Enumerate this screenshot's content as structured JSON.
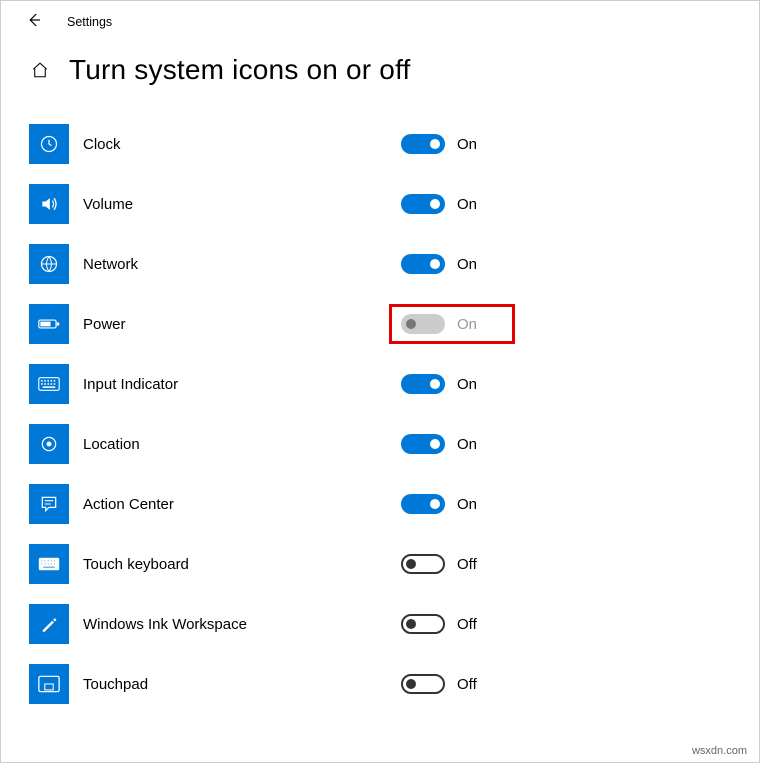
{
  "header": {
    "app_label": "Settings",
    "page_title": "Turn system icons on or off"
  },
  "states": {
    "on": "On",
    "off": "Off"
  },
  "items": [
    {
      "id": "clock",
      "label": "Clock",
      "enabled": true,
      "on": true
    },
    {
      "id": "volume",
      "label": "Volume",
      "enabled": true,
      "on": true
    },
    {
      "id": "network",
      "label": "Network",
      "enabled": true,
      "on": true
    },
    {
      "id": "power",
      "label": "Power",
      "enabled": false,
      "on": false,
      "highlight": true
    },
    {
      "id": "input-indicator",
      "label": "Input Indicator",
      "enabled": true,
      "on": true
    },
    {
      "id": "location",
      "label": "Location",
      "enabled": true,
      "on": true
    },
    {
      "id": "action-center",
      "label": "Action Center",
      "enabled": true,
      "on": true
    },
    {
      "id": "touch-keyboard",
      "label": "Touch keyboard",
      "enabled": true,
      "on": false
    },
    {
      "id": "windows-ink",
      "label": "Windows Ink Workspace",
      "enabled": true,
      "on": false
    },
    {
      "id": "touchpad",
      "label": "Touchpad",
      "enabled": true,
      "on": false
    }
  ],
  "watermark": "wsxdn.com"
}
